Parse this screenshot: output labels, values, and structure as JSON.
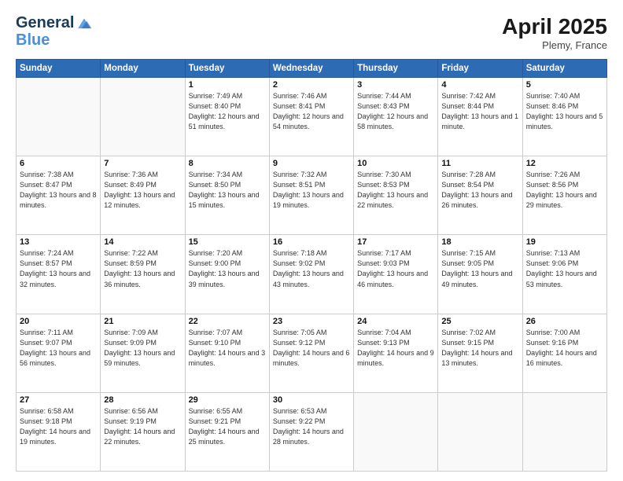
{
  "logo": {
    "line1": "General",
    "line2": "Blue"
  },
  "header": {
    "month": "April 2025",
    "location": "Plemy, France"
  },
  "weekdays": [
    "Sunday",
    "Monday",
    "Tuesday",
    "Wednesday",
    "Thursday",
    "Friday",
    "Saturday"
  ],
  "weeks": [
    [
      {
        "num": "",
        "info": ""
      },
      {
        "num": "",
        "info": ""
      },
      {
        "num": "1",
        "info": "Sunrise: 7:49 AM\nSunset: 8:40 PM\nDaylight: 12 hours and 51 minutes."
      },
      {
        "num": "2",
        "info": "Sunrise: 7:46 AM\nSunset: 8:41 PM\nDaylight: 12 hours and 54 minutes."
      },
      {
        "num": "3",
        "info": "Sunrise: 7:44 AM\nSunset: 8:43 PM\nDaylight: 12 hours and 58 minutes."
      },
      {
        "num": "4",
        "info": "Sunrise: 7:42 AM\nSunset: 8:44 PM\nDaylight: 13 hours and 1 minute."
      },
      {
        "num": "5",
        "info": "Sunrise: 7:40 AM\nSunset: 8:46 PM\nDaylight: 13 hours and 5 minutes."
      }
    ],
    [
      {
        "num": "6",
        "info": "Sunrise: 7:38 AM\nSunset: 8:47 PM\nDaylight: 13 hours and 8 minutes."
      },
      {
        "num": "7",
        "info": "Sunrise: 7:36 AM\nSunset: 8:49 PM\nDaylight: 13 hours and 12 minutes."
      },
      {
        "num": "8",
        "info": "Sunrise: 7:34 AM\nSunset: 8:50 PM\nDaylight: 13 hours and 15 minutes."
      },
      {
        "num": "9",
        "info": "Sunrise: 7:32 AM\nSunset: 8:51 PM\nDaylight: 13 hours and 19 minutes."
      },
      {
        "num": "10",
        "info": "Sunrise: 7:30 AM\nSunset: 8:53 PM\nDaylight: 13 hours and 22 minutes."
      },
      {
        "num": "11",
        "info": "Sunrise: 7:28 AM\nSunset: 8:54 PM\nDaylight: 13 hours and 26 minutes."
      },
      {
        "num": "12",
        "info": "Sunrise: 7:26 AM\nSunset: 8:56 PM\nDaylight: 13 hours and 29 minutes."
      }
    ],
    [
      {
        "num": "13",
        "info": "Sunrise: 7:24 AM\nSunset: 8:57 PM\nDaylight: 13 hours and 32 minutes."
      },
      {
        "num": "14",
        "info": "Sunrise: 7:22 AM\nSunset: 8:59 PM\nDaylight: 13 hours and 36 minutes."
      },
      {
        "num": "15",
        "info": "Sunrise: 7:20 AM\nSunset: 9:00 PM\nDaylight: 13 hours and 39 minutes."
      },
      {
        "num": "16",
        "info": "Sunrise: 7:18 AM\nSunset: 9:02 PM\nDaylight: 13 hours and 43 minutes."
      },
      {
        "num": "17",
        "info": "Sunrise: 7:17 AM\nSunset: 9:03 PM\nDaylight: 13 hours and 46 minutes."
      },
      {
        "num": "18",
        "info": "Sunrise: 7:15 AM\nSunset: 9:05 PM\nDaylight: 13 hours and 49 minutes."
      },
      {
        "num": "19",
        "info": "Sunrise: 7:13 AM\nSunset: 9:06 PM\nDaylight: 13 hours and 53 minutes."
      }
    ],
    [
      {
        "num": "20",
        "info": "Sunrise: 7:11 AM\nSunset: 9:07 PM\nDaylight: 13 hours and 56 minutes."
      },
      {
        "num": "21",
        "info": "Sunrise: 7:09 AM\nSunset: 9:09 PM\nDaylight: 13 hours and 59 minutes."
      },
      {
        "num": "22",
        "info": "Sunrise: 7:07 AM\nSunset: 9:10 PM\nDaylight: 14 hours and 3 minutes."
      },
      {
        "num": "23",
        "info": "Sunrise: 7:05 AM\nSunset: 9:12 PM\nDaylight: 14 hours and 6 minutes."
      },
      {
        "num": "24",
        "info": "Sunrise: 7:04 AM\nSunset: 9:13 PM\nDaylight: 14 hours and 9 minutes."
      },
      {
        "num": "25",
        "info": "Sunrise: 7:02 AM\nSunset: 9:15 PM\nDaylight: 14 hours and 13 minutes."
      },
      {
        "num": "26",
        "info": "Sunrise: 7:00 AM\nSunset: 9:16 PM\nDaylight: 14 hours and 16 minutes."
      }
    ],
    [
      {
        "num": "27",
        "info": "Sunrise: 6:58 AM\nSunset: 9:18 PM\nDaylight: 14 hours and 19 minutes."
      },
      {
        "num": "28",
        "info": "Sunrise: 6:56 AM\nSunset: 9:19 PM\nDaylight: 14 hours and 22 minutes."
      },
      {
        "num": "29",
        "info": "Sunrise: 6:55 AM\nSunset: 9:21 PM\nDaylight: 14 hours and 25 minutes."
      },
      {
        "num": "30",
        "info": "Sunrise: 6:53 AM\nSunset: 9:22 PM\nDaylight: 14 hours and 28 minutes."
      },
      {
        "num": "",
        "info": ""
      },
      {
        "num": "",
        "info": ""
      },
      {
        "num": "",
        "info": ""
      }
    ]
  ]
}
